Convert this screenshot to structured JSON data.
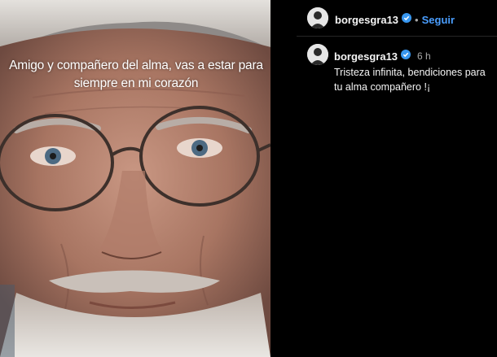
{
  "post": {
    "caption": "Amigo y compañero del alma, vas a estar para siempre en mi corazón"
  },
  "header": {
    "username": "borgesgra13",
    "separator": "•",
    "follow_label": "Seguir"
  },
  "comment": {
    "username": "borgesgra13",
    "time": "6 h",
    "text": "Tristeza infinita, bendiciones para tu alma compañero !¡"
  },
  "colors": {
    "background": "#000000",
    "verified": "#3897f0",
    "follow": "#4a9eff"
  },
  "icons": [
    "verified-badge-icon",
    "avatar"
  ]
}
